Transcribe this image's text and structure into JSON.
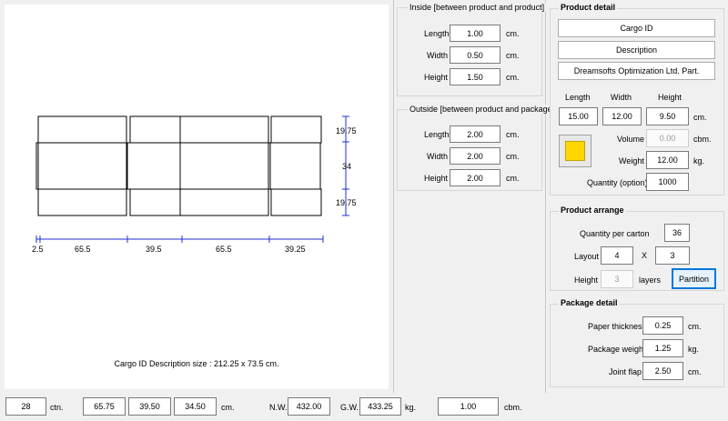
{
  "diagram": {
    "caption": "Cargo ID Description size : 212.25 x 73.5 cm.",
    "bottom_dims": [
      "2.5",
      "65.5",
      "39.5",
      "65.5",
      "39.25"
    ],
    "right_dims": [
      "19.75",
      "34",
      "19.75"
    ]
  },
  "inside": {
    "title": "Inside [between product and product]",
    "length_label": "Length",
    "length_value": "1.00",
    "width_label": "Width",
    "width_value": "0.50",
    "height_label": "Height",
    "height_value": "1.50",
    "unit": "cm."
  },
  "outside": {
    "title": "Outside [between product and package]",
    "length_label": "Length",
    "length_value": "2.00",
    "width_label": "Width",
    "width_value": "2.00",
    "height_label": "Height",
    "height_value": "2.00",
    "unit": "cm."
  },
  "product_detail": {
    "title": "Product detail",
    "cargo_id": "Cargo ID",
    "description": "Description",
    "company": "Dreamsofts Optimization Ltd. Part.",
    "length_label": "Length",
    "width_label": "Width",
    "height_label": "Height",
    "length_value": "15.00",
    "width_value": "12.00",
    "height_value": "9.50",
    "dim_unit": "cm.",
    "volume_label": "Volume",
    "volume_value": "0.00",
    "volume_unit": "cbm.",
    "weight_label": "Weight",
    "weight_value": "12.00",
    "weight_unit": "kg.",
    "quantity_label": "Quantity (option)",
    "quantity_value": "1000",
    "color": "#ffd700"
  },
  "product_arrange": {
    "title": "Product arrange",
    "qty_label": "Quantity per carton",
    "qty_value": "36",
    "layout_label": "Layout",
    "layout_x": "4",
    "layout_sep": "X",
    "layout_y": "3",
    "height_label": "Height",
    "height_value": "3",
    "height_unit": "layers",
    "partition_button": "Partition"
  },
  "package_detail": {
    "title": "Package detail",
    "paper_label": "Paper thickness",
    "paper_value": "0.25",
    "paper_unit": "cm.",
    "weight_label": "Package weight",
    "weight_value": "1.25",
    "weight_unit": "kg.",
    "flap_label": "Joint flap",
    "flap_value": "2.50",
    "flap_unit": "cm."
  },
  "status": {
    "cartons": "28",
    "cartons_unit": "ctn.",
    "length": "65.75",
    "width": "39.50",
    "height": "34.50",
    "dim_unit": "cm.",
    "nw_label": "N.W.",
    "nw_value": "432.00",
    "gw_label": "G.W.",
    "gw_value": "433.25",
    "weight_unit": "kg.",
    "cbm_value": "1.00",
    "cbm_unit": "cbm."
  }
}
